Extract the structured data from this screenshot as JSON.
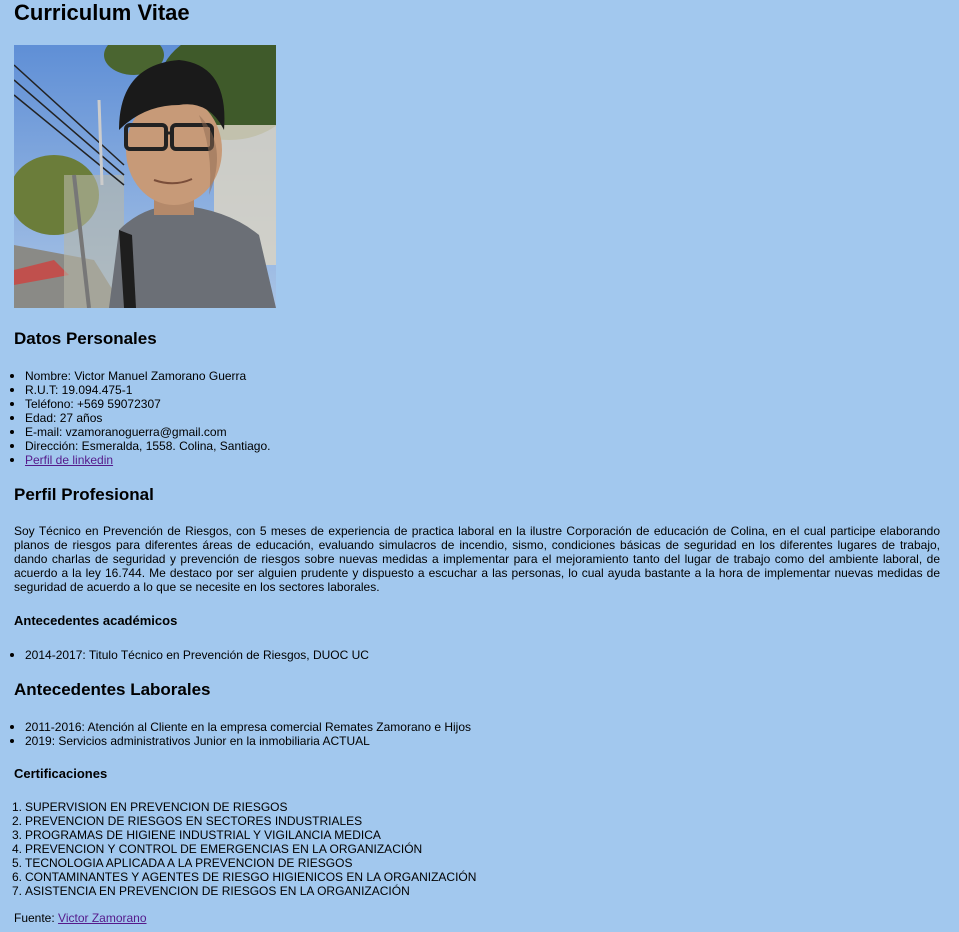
{
  "title": "Curriculum Vitae",
  "photo": {
    "alt": "Foto de perfil"
  },
  "personal": {
    "heading": "Datos Personales",
    "items": [
      "Nombre: Victor Manuel Zamorano Guerra",
      "R.U.T: 19.094.475-1",
      "Teléfono: +569 59072307",
      "Edad: 27 años",
      "E-mail: vzamoranoguerra@gmail.com",
      "Dirección: Esmeralda, 1558. Colina, Santiago."
    ],
    "linkedin_label": "Perfil de linkedin"
  },
  "profile": {
    "heading": "Perfil Profesional",
    "text": "Soy Técnico en Prevención de Riesgos, con 5 meses de experiencia de practica laboral en la ilustre Corporación de educación de Colina, en el cual participe elaborando planos de riesgos para diferentes áreas de educación, evaluando simulacros de incendio, sismo, condiciones básicas de seguridad en los diferentes lugares de trabajo, dando charlas de seguridad y prevención de riesgos sobre nuevas medidas a implementar para el mejoramiento tanto del lugar de trabajo como del ambiente laboral, de acuerdo a la ley 16.744. Me destaco por ser alguien prudente y dispuesto a escuchar a las personas, lo cual ayuda bastante a la hora de implementar nuevas medidas de seguridad de acuerdo a lo que se necesite en los sectores laborales."
  },
  "academic": {
    "heading": "Antecedentes académicos",
    "items": [
      "2014-2017: Titulo Técnico en Prevención de Riesgos, DUOC UC"
    ]
  },
  "work": {
    "heading": "Antecedentes Laborales",
    "items": [
      "2011-2016: Atención al Cliente en la empresa comercial Remates Zamorano e Hijos",
      "2019: Servicios administrativos Junior en la inmobiliaria ACTUAL"
    ]
  },
  "certs": {
    "heading": "Certificaciones",
    "items": [
      "SUPERVISION EN PREVENCION DE RIESGOS",
      "PREVENCION DE RIESGOS EN SECTORES INDUSTRIALES",
      "PROGRAMAS DE HIGIENE INDUSTRIAL Y VIGILANCIA MEDICA",
      "PREVENCION Y CONTROL DE EMERGENCIAS EN LA ORGANIZACIÓN",
      "TECNOLOGIA APLICADA A LA PREVENCION DE RIESGOS",
      "CONTAMINANTES Y AGENTES DE RIESGO HIGIENICOS EN LA ORGANIZACIÓN",
      "ASISTENCIA EN PREVENCION DE RIESGOS EN LA ORGANIZACIÓN"
    ],
    "numbers": [
      "1.",
      "2.",
      "3.",
      "4.",
      "5.",
      "6.",
      "7."
    ]
  },
  "footer": {
    "label": "Fuente: ",
    "link_label": "Victor Zamorano"
  },
  "colors": {
    "background": "#a2c8ee",
    "link": "#551a8b",
    "text": "#000000"
  }
}
